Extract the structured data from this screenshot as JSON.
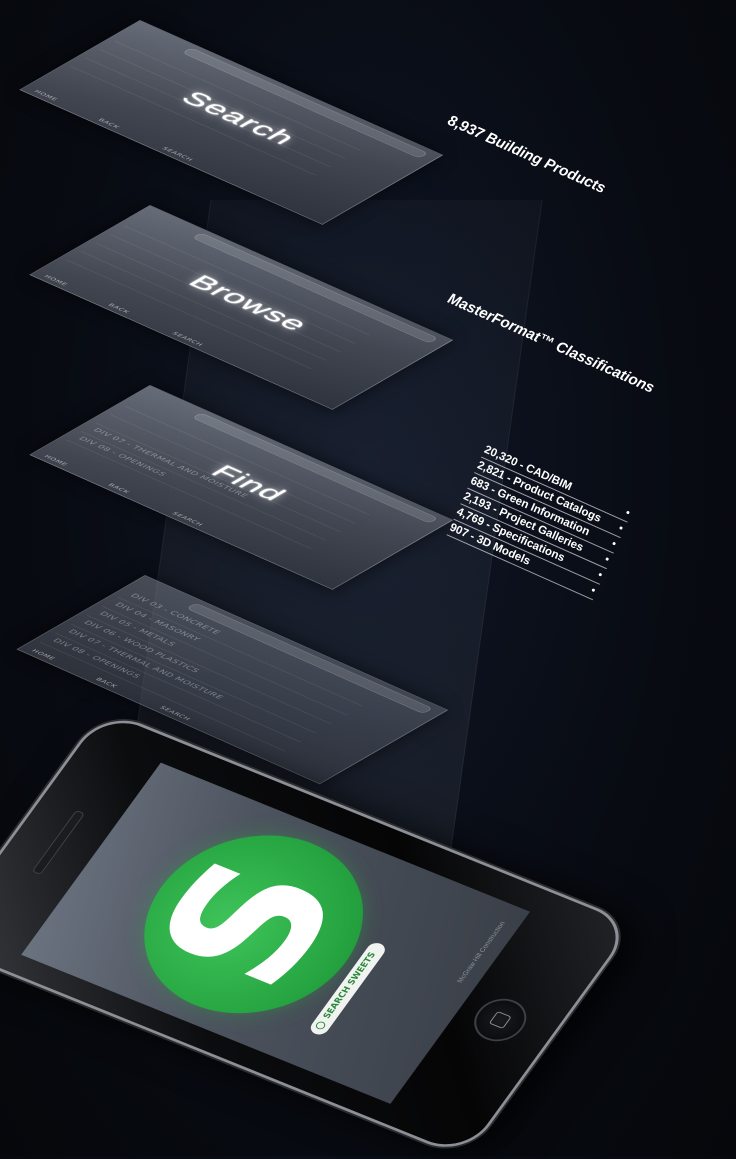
{
  "layers": [
    {
      "id": "search",
      "title": "Search",
      "rows": [
        "",
        "",
        "",
        ""
      ],
      "nav": [
        "HOME",
        "BACK",
        "SEARCH"
      ]
    },
    {
      "id": "browse",
      "title": "Browse",
      "rows": [
        "",
        "",
        "",
        "",
        ""
      ],
      "nav": [
        "HOME",
        "BACK",
        "SEARCH"
      ]
    },
    {
      "id": "find",
      "title": "Find",
      "rows": [
        "",
        "",
        "",
        "DIV 07 - THERMAL AND MOISTURE",
        "DIV 08 - OPENINGS"
      ],
      "nav": [
        "HOME",
        "BACK",
        "SEARCH"
      ]
    },
    {
      "id": "list",
      "title": "",
      "rows": [
        "DIV 03 - CONCRETE",
        "DIV 04 - MASONRY",
        "DIV 05 - METALS",
        "DIV 06 - WOOD PLASTICS",
        "DIV 07 - THERMAL AND MOISTURE",
        "DIV 08 - OPENINGS"
      ],
      "nav": [
        "HOME",
        "BACK",
        "SEARCH"
      ]
    }
  ],
  "callouts": {
    "search": "8,937 Building Products",
    "browse": "MasterFormat™ Classifications"
  },
  "stats": [
    "20,320 - CAD/BIM",
    "2,821 - Product Catalogs",
    "683 - Green Information",
    "2,193 - Project Galleries",
    "4,769 - Specifications",
    "907 - 3D Models"
  ],
  "phone": {
    "logo_letter": "S",
    "search_button_label": "SEARCH SWEETS",
    "footer_text": "McGraw Hill Construction",
    "logo_color": "#2fb24a"
  },
  "colors": {
    "background": "#080b12",
    "accent_green": "#2fb24a"
  }
}
